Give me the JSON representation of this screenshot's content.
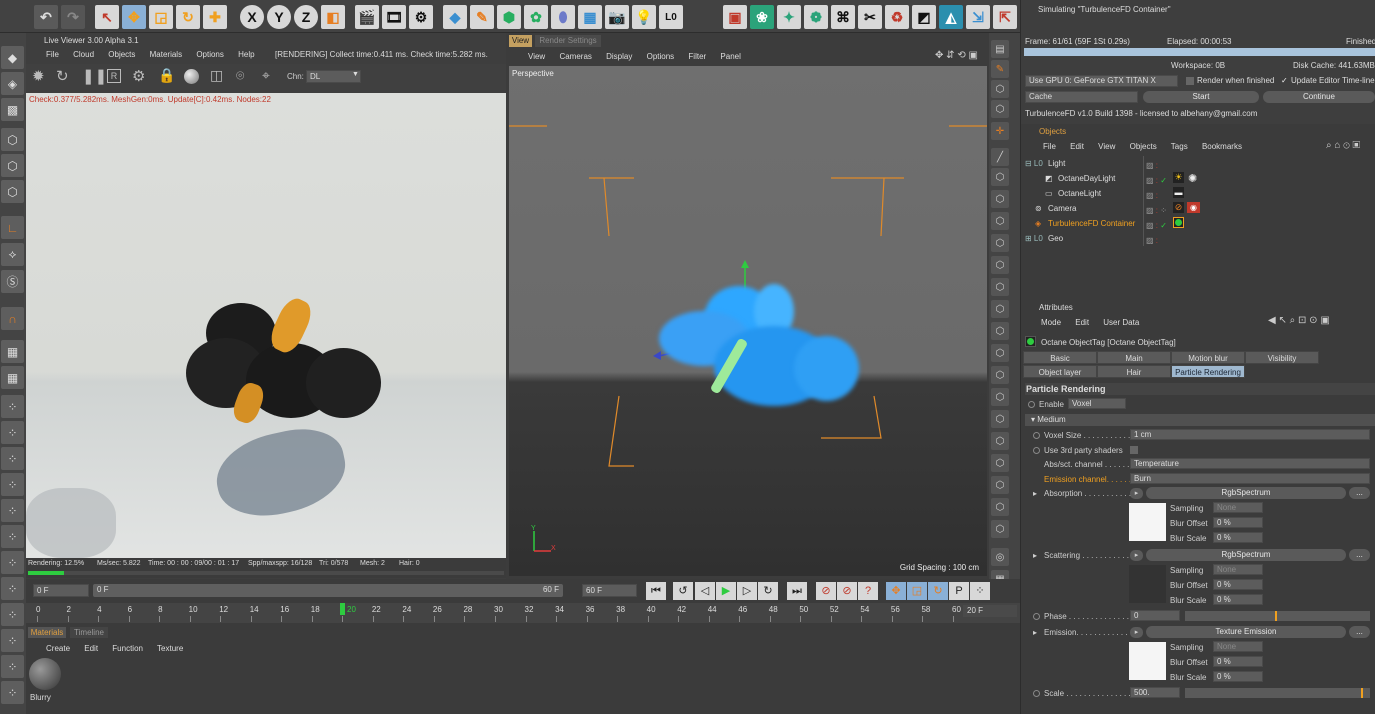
{
  "toolbar": {
    "undo_label": "↶",
    "axis_buttons": [
      "X",
      "Y",
      "Z"
    ]
  },
  "live_viewer": {
    "title": "Live Viewer 3.00 Alpha 3.1",
    "menu": [
      "File",
      "Cloud",
      "Objects",
      "Materials",
      "Options",
      "Help"
    ],
    "render_status": "[RENDERING] Collect time:0.411 ms.  Check time:5.282 ms.",
    "channel_label": "Chn:",
    "channel_value": "DL",
    "overlay_text": "Check:0.377/5.282ms. MeshGen:0ms. Update[C]:0.42ms. Nodes:22",
    "status_rendering": "Rendering: 12.5%",
    "status_mssec": "Ms/sec: 5.822",
    "status_time": "Time: 00 : 00 : 09/00 : 01 : 17",
    "status_spp": "Spp/maxspp: 16/128",
    "status_tri": "Tri: 0/578",
    "status_mesh": "Mesh: 2",
    "status_hair": "Hair: 0",
    "progress": 0.125
  },
  "viewport": {
    "tabs": [
      "View",
      "Render Settings"
    ],
    "menu": [
      "View",
      "Cameras",
      "Display",
      "Options",
      "Filter",
      "Panel"
    ],
    "camera_label": "Perspective",
    "grid_spacing": "Grid Spacing : 100 cm",
    "axis_y": "Y",
    "axis_x": "X"
  },
  "timeline": {
    "start_field": "0 F",
    "slider_start": "0 F",
    "slider_end": "60 F",
    "end_field": "60 F",
    "ticks": [
      "0",
      "2",
      "4",
      "6",
      "8",
      "10",
      "12",
      "14",
      "16",
      "18",
      "20",
      "22",
      "24",
      "26",
      "28",
      "30",
      "32",
      "34",
      "36",
      "38",
      "40",
      "42",
      "44",
      "46",
      "48",
      "50",
      "52",
      "54",
      "56",
      "58",
      "60"
    ],
    "current_frame": "20",
    "end_label": "20 F"
  },
  "materials": {
    "tabs": [
      "Materials",
      "Timeline"
    ],
    "menu": [
      "Create",
      "Edit",
      "Function",
      "Texture"
    ],
    "items": [
      {
        "name": "Blurry"
      }
    ]
  },
  "sim_panel": {
    "title": "Simulating \"TurbulenceFD Container\"",
    "frame": "Frame: 61/61 (59F 1St 0.29s)",
    "elapsed": "Elapsed: 00:00:53",
    "finished": "Finished",
    "workspace": "Workspace: 0B",
    "disk_cache": "Disk Cache: 441.63MB",
    "gpu_select": "Use GPU 0: GeForce GTX TITAN X",
    "render_when_finished": "Render when finished",
    "update_editor": "Update Editor Time-line",
    "cache_select": "Cache",
    "start_button": "Start",
    "continue_button": "Continue",
    "license": "TurbulenceFD v1.0 Build 1398 - licensed to albehany@gmail.com"
  },
  "objects_panel": {
    "title": "Objects",
    "menu": [
      "File",
      "Edit",
      "View",
      "Objects",
      "Tags",
      "Bookmarks"
    ],
    "rows": [
      {
        "name": "Light",
        "indent": 0
      },
      {
        "name": "OctaneDayLight",
        "indent": 1
      },
      {
        "name": "OctaneLight",
        "indent": 1
      },
      {
        "name": "Camera",
        "indent": 0
      },
      {
        "name": "TurbulenceFD Container",
        "indent": 0
      },
      {
        "name": "Geo",
        "indent": 0
      }
    ]
  },
  "attributes": {
    "title": "Attributes",
    "menu": [
      "Mode",
      "Edit",
      "User Data"
    ],
    "tag_title": "Octane ObjectTag [Octane ObjectTag]",
    "tabs_row1": [
      "Basic",
      "Main",
      "Motion blur",
      "Visibility"
    ],
    "tabs_row2": [
      "Object layer",
      "Hair",
      "Particle Rendering"
    ],
    "section": "Particle Rendering",
    "enable_label": "Enable",
    "enable_value": "Voxel",
    "medium_label": "Medium",
    "voxel_size_label": "Voxel Size . . . . . . . . . . . .",
    "voxel_size_value": "1 cm",
    "third_party_label": "Use 3rd party shaders",
    "abs_channel_label": "Abs/sct. channel . . . . . . .",
    "abs_channel_value": "Temperature",
    "emission_channel_label": "Emission channel. . . . . .",
    "emission_channel_value": "Burn",
    "absorption_label": "Absorption . . . . . . . . . . .",
    "absorption_value": "RgbSpectrum",
    "scattering_label": "Scattering . . . . . . . . . . . .",
    "scattering_value": "RgbSpectrum",
    "sampling_label": "Sampling",
    "sampling_value": "None",
    "blur_offset_label": "Blur Offset",
    "blur_offset_value": "0 %",
    "blur_scale_label": "Blur Scale",
    "blur_scale_value": "0 %",
    "phase_label": "Phase . . . . . . . . . . . . . .",
    "phase_value": "0",
    "emission_label": "Emission. . . . . . . . . . . . .",
    "emission_value": "Texture Emission",
    "scale_label": "Scale . . . . . . . . . . . . . . .",
    "scale_value": "500.",
    "more_btn": "..."
  }
}
